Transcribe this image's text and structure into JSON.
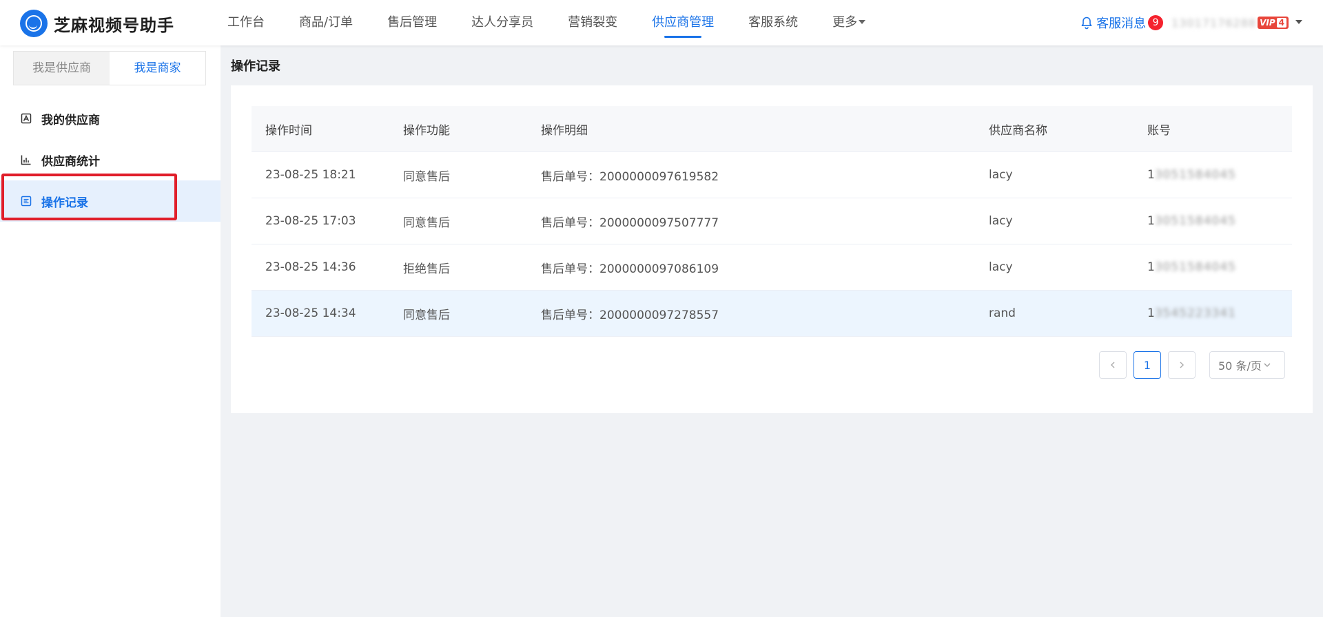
{
  "header": {
    "app_name": "芝麻视频号助手",
    "nav": [
      "工作台",
      "商品/订单",
      "售后管理",
      "达人分享员",
      "营销裂变",
      "供应商管理",
      "客服系统",
      "更多"
    ],
    "nav_active_index": 5,
    "messages_label": "客服消息",
    "messages_count": "9",
    "account": "13017176288",
    "vip_label": "VIP",
    "vip_level": "4"
  },
  "sidebar": {
    "roles": [
      "我是供应商",
      "我是商家"
    ],
    "active_role_index": 1,
    "menu": [
      {
        "label": "我的供应商",
        "icon": "supplier-icon"
      },
      {
        "label": "供应商统计",
        "icon": "chart-icon"
      },
      {
        "label": "操作记录",
        "icon": "record-icon"
      }
    ],
    "active_menu_index": 2
  },
  "main": {
    "title": "操作记录",
    "columns": [
      "操作时间",
      "操作功能",
      "操作明细",
      "供应商名称",
      "账号"
    ],
    "rows": [
      {
        "time": "23-08-25 18:21",
        "func": "同意售后",
        "detail": "售后单号：2000000097619582",
        "supplier": "lacy",
        "acct_first": "1",
        "acct_rest": "3051584045"
      },
      {
        "time": "23-08-25 17:03",
        "func": "同意售后",
        "detail": "售后单号：2000000097507777",
        "supplier": "lacy",
        "acct_first": "1",
        "acct_rest": "3051584045"
      },
      {
        "time": "23-08-25 14:36",
        "func": "拒绝售后",
        "detail": "售后单号：2000000097086109",
        "supplier": "lacy",
        "acct_first": "1",
        "acct_rest": "3051584045"
      },
      {
        "time": "23-08-25 14:34",
        "func": "同意售后",
        "detail": "售后单号：2000000097278557",
        "supplier": "rand",
        "acct_first": "1",
        "acct_rest": "3545223341"
      }
    ],
    "pagination": {
      "prev": "<",
      "current": "1",
      "next": ">",
      "page_size": "50 条/页"
    }
  },
  "colors": {
    "accent": "#1a73e8",
    "highlight": "#e01e2a",
    "badge": "#f5222d"
  }
}
